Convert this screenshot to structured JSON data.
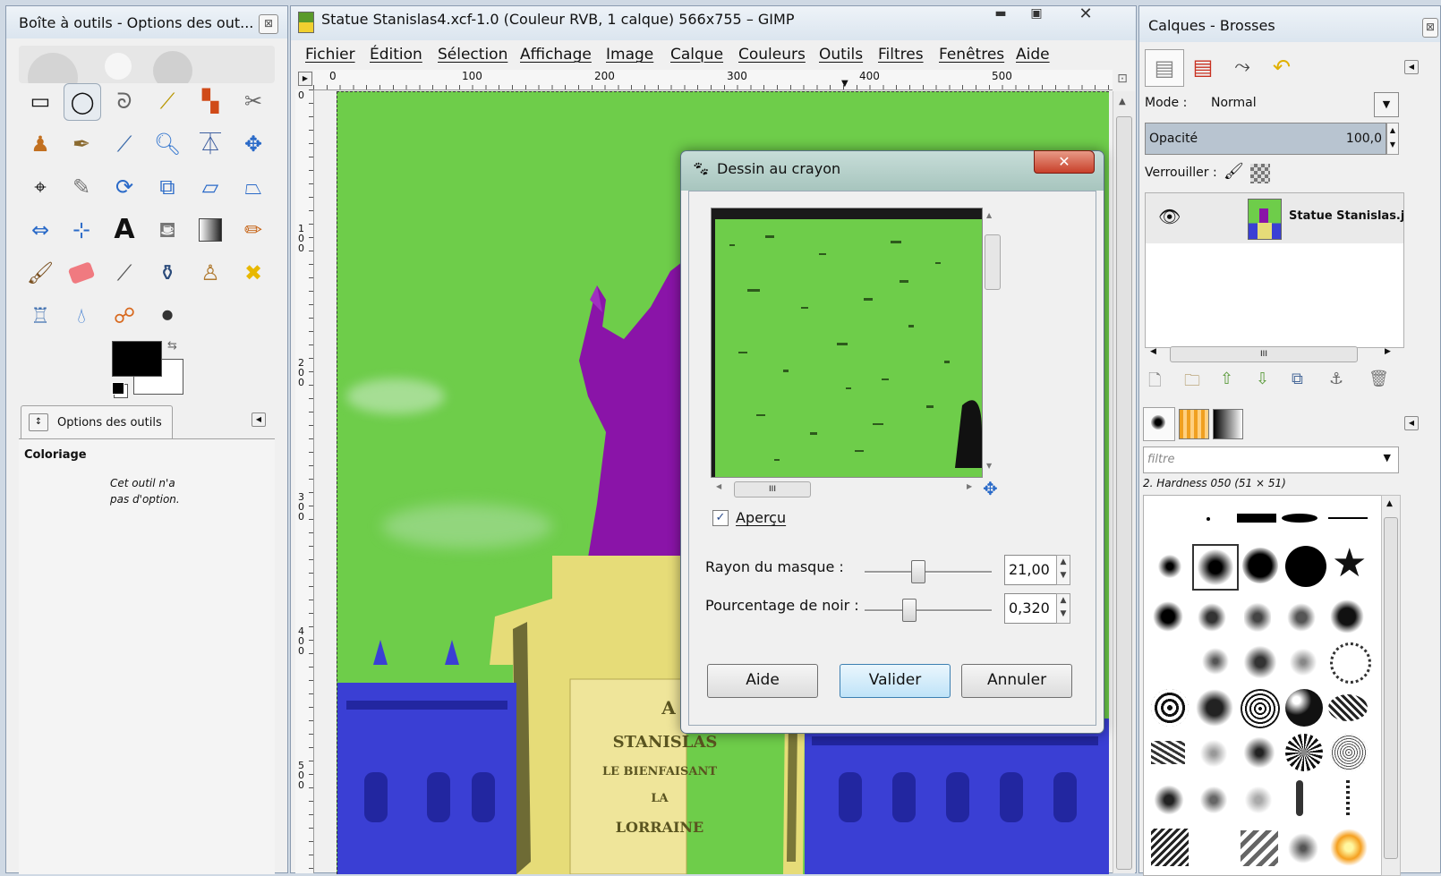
{
  "toolbox": {
    "title": "Boîte à outils - Options des out...",
    "options_tab": "Options des outils",
    "tool_name": "Coloriage",
    "no_option_line1": "Cet outil n'a",
    "no_option_line2": "pas d'option."
  },
  "image_window": {
    "title": "Statue Stanislas4.xcf-1.0 (Couleur RVB, 1 calque) 566x755 – GIMP",
    "menu": [
      "Fichier",
      "Édition",
      "Sélection",
      "Affichage",
      "Image",
      "Calque",
      "Couleurs",
      "Outils",
      "Filtres",
      "Fenêtres",
      "Aide"
    ],
    "ruler_top": [
      "0",
      "100",
      "200",
      "300",
      "400",
      "500"
    ],
    "ruler_left": [
      "0",
      "1\n0\n0",
      "2\n0\n0",
      "3\n0\n0",
      "4\n0\n0",
      "5\n0\n0"
    ],
    "inscription": [
      "A",
      "STANISLAS",
      "LE BIENFAISANT",
      "LA",
      "LORRAINE"
    ]
  },
  "dialog": {
    "title": "Dessin au crayon",
    "preview_label": "Aperçu",
    "preview_checked": true,
    "radius_label": "Rayon du masque :",
    "radius_value": "21,00",
    "black_label": "Pourcentage de noir :",
    "black_value": "0,320",
    "help_button": "Aide",
    "ok_button": "Valider",
    "cancel_button": "Annuler",
    "preview_hscroll": "III"
  },
  "layers_panel": {
    "title": "Calques - Brosses",
    "mode_label": "Mode :",
    "mode_value": "Normal",
    "opacity_label": "Opacité",
    "opacity_value": "100,0",
    "lock_label": "Verrouiller :",
    "layer_name": "Statue Stanislas.jp",
    "hscroll": "III",
    "brush_filter_placeholder": "filtre",
    "brush_name": "2. Hardness 050 (51 × 51)"
  },
  "colors": {
    "sky_green": "#6ecd4a",
    "statue_purple": "#8a14a8",
    "pedestal_yellow": "#e6dc78",
    "building_blue": "#3a3fd4"
  }
}
